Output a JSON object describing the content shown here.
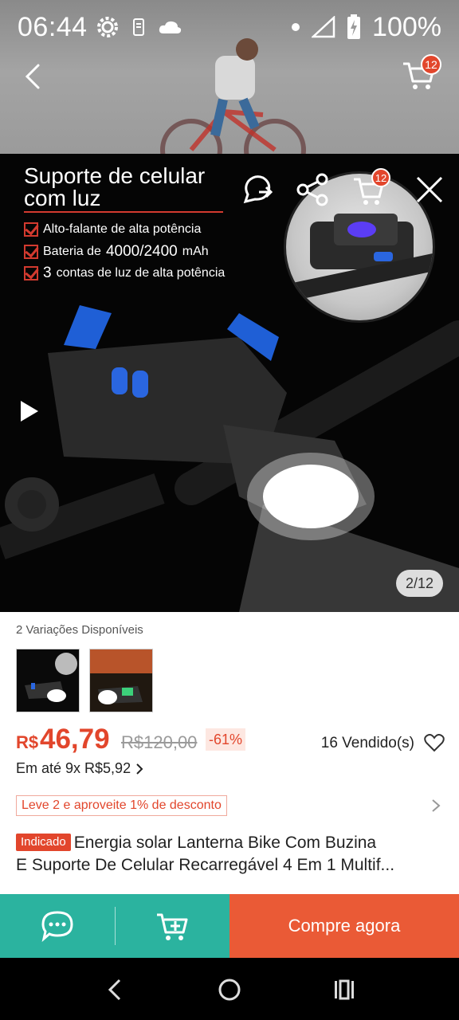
{
  "status_bar": {
    "time": "06:44",
    "battery": "100%",
    "icons": [
      "gear-icon",
      "phone-icon",
      "cloud-icon",
      "dot-icon",
      "signal-icon",
      "battery-charging-icon"
    ]
  },
  "header": {
    "cart_count": "12"
  },
  "product_image": {
    "title_line1": "Suporte de celular",
    "title_line2": "com luz",
    "features": [
      "Alto-falante de alta potência",
      "4000/2400",
      "3",
      "contas de luz de alta potência"
    ],
    "feature2_prefix": "Bateria de",
    "feature2_suffix": "mAh",
    "cart_count": "12",
    "page_counter": "2/12"
  },
  "product": {
    "variations_label": "2 Variações Disponíveis",
    "currency": "R$",
    "price": "46,79",
    "old_price": "R$120,00",
    "discount": "-61%",
    "sold": "16 Vendido(s)",
    "installments": "Em até 9x R$5,92",
    "promo": "Leve 2 e aproveite 1% de desconto",
    "badge": "Indicado",
    "title_line1": "Energia solar Lanterna Bike Com Buzina",
    "title_line2": "E Suporte De Celular Recarregável 4 Em 1 Multif..."
  },
  "actions": {
    "buy_label": "Compre agora"
  },
  "colors": {
    "accent": "#e2462c",
    "teal": "#2bb39f",
    "buy": "#ea5a36"
  }
}
